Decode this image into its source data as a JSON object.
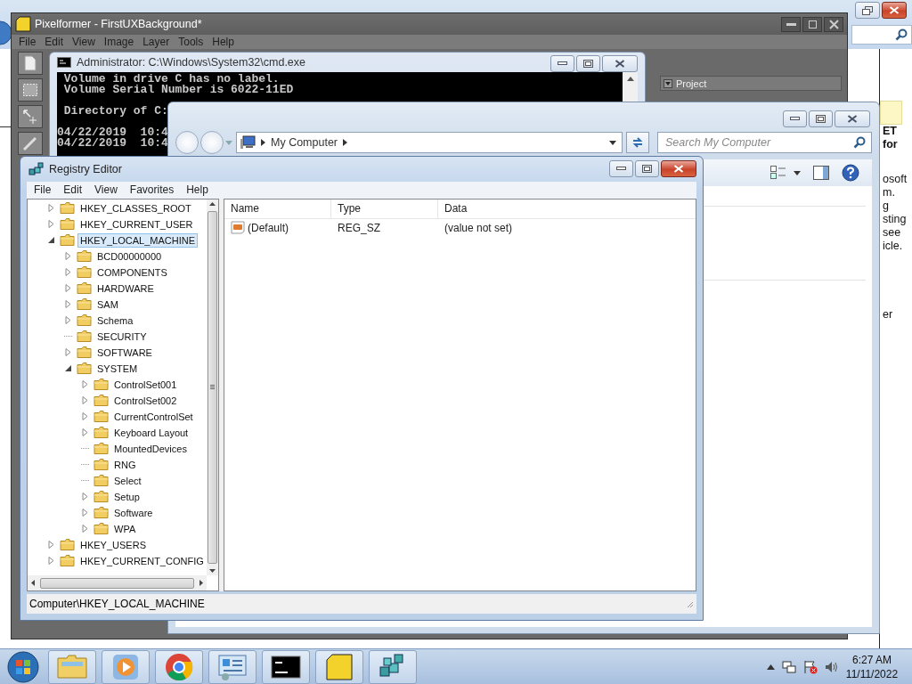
{
  "background_window": {
    "side_text": {
      "heading": [
        "ET",
        "for"
      ],
      "lines": [
        "osoft",
        "m.",
        "g",
        "sting",
        "see",
        "icle."
      ],
      "lines_after": [
        "er"
      ]
    }
  },
  "pixelformer": {
    "title": "Pixelformer - FirstUXBackground*",
    "menu": [
      "File",
      "Edit",
      "View",
      "Image",
      "Layer",
      "Tools",
      "Help"
    ],
    "panel": {
      "title": "Project"
    }
  },
  "cmd": {
    "title": "Administrator: C:\\Windows\\System32\\cmd.exe",
    "blocks": [
      {
        "lines": [
          " Volume in drive C has no label.",
          " Volume Serial Number is 6022-11ED"
        ]
      },
      {
        "lines": [
          " Directory of C:"
        ]
      },
      {
        "lines": [
          "04/22/2019  10:4",
          "04/22/2019  10:4"
        ]
      }
    ]
  },
  "explorer": {
    "address": "My Computer",
    "search": {
      "placeholder": "Search My Computer"
    }
  },
  "registry": {
    "title": "Registry Editor",
    "menu": [
      "File",
      "Edit",
      "View",
      "Favorites",
      "Help"
    ],
    "tree": [
      {
        "label": "HKEY_CLASSES_ROOT",
        "kind": "branch",
        "expanded": false,
        "selected": false
      },
      {
        "label": "HKEY_CURRENT_USER",
        "kind": "branch",
        "expanded": false,
        "selected": false
      },
      {
        "label": "HKEY_LOCAL_MACHINE",
        "kind": "branch",
        "expanded": true,
        "selected": true,
        "children": [
          {
            "label": "BCD00000000",
            "kind": "branch",
            "expanded": false,
            "selected": false
          },
          {
            "label": "COMPONENTS",
            "kind": "branch",
            "expanded": false,
            "selected": false
          },
          {
            "label": "HARDWARE",
            "kind": "branch",
            "expanded": false,
            "selected": false
          },
          {
            "label": "SAM",
            "kind": "branch",
            "expanded": false,
            "selected": false
          },
          {
            "label": "Schema",
            "kind": "branch",
            "expanded": false,
            "selected": false
          },
          {
            "label": "SECURITY",
            "kind": "leaf",
            "selected": false
          },
          {
            "label": "SOFTWARE",
            "kind": "branch",
            "expanded": false,
            "selected": false
          },
          {
            "label": "SYSTEM",
            "kind": "branch",
            "expanded": true,
            "selected": false,
            "children": [
              {
                "label": "ControlSet001",
                "kind": "branch",
                "expanded": false,
                "selected": false
              },
              {
                "label": "ControlSet002",
                "kind": "branch",
                "expanded": false,
                "selected": false
              },
              {
                "label": "CurrentControlSet",
                "kind": "branch",
                "expanded": false,
                "selected": false
              },
              {
                "label": "Keyboard Layout",
                "kind": "branch",
                "expanded": false,
                "selected": false
              },
              {
                "label": "MountedDevices",
                "kind": "leaf",
                "selected": false
              },
              {
                "label": "RNG",
                "kind": "leaf",
                "selected": false
              },
              {
                "label": "Select",
                "kind": "leaf",
                "selected": false
              },
              {
                "label": "Setup",
                "kind": "branch",
                "expanded": false,
                "selected": false
              },
              {
                "label": "Software",
                "kind": "branch",
                "expanded": false,
                "selected": false
              },
              {
                "label": "WPA",
                "kind": "branch",
                "expanded": false,
                "selected": false
              }
            ]
          }
        ]
      },
      {
        "label": "HKEY_USERS",
        "kind": "branch",
        "expanded": false,
        "selected": false
      },
      {
        "label": "HKEY_CURRENT_CONFIG",
        "kind": "branch",
        "expanded": false,
        "selected": false
      }
    ],
    "columns": [
      "Name",
      "Type",
      "Data"
    ],
    "rows": [
      {
        "name": "(Default)",
        "type": "REG_SZ",
        "data": "(value not set)"
      }
    ],
    "status_bar": "Computer\\HKEY_LOCAL_MACHINE"
  },
  "taskbar": {
    "time": "6:27 AM",
    "date": "11/11/2022"
  }
}
